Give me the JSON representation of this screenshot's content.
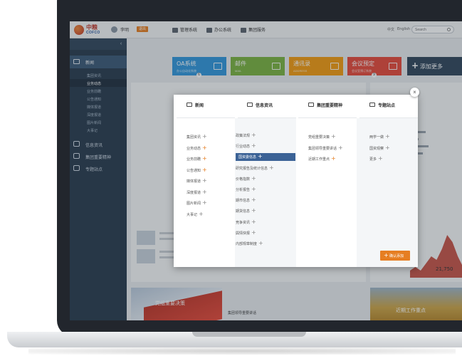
{
  "colors": {
    "sidebar": "#2c3e50",
    "sidebar_active": "#3d5a78",
    "accent_orange": "#e67e22",
    "tile_blue": "#3498db",
    "tile_green": "#7cb342",
    "tile_orange": "#f39c12",
    "tile_red": "#e74c3c",
    "tile_dark": "#34495e",
    "selected_item": "#3b6296"
  },
  "header": {
    "logo_cn": "中粮",
    "logo_en": "COFCO",
    "user_name": "李明",
    "user_tag": "退出",
    "nav": [
      {
        "label": "管理系统",
        "icon": "gear-icon"
      },
      {
        "label": "办公系统",
        "icon": "monitor-icon"
      },
      {
        "label": "集团服务",
        "icon": "eye-icon"
      }
    ],
    "lang_cn": "中文",
    "lang_en": "English",
    "search_placeholder": "Search"
  },
  "sidebar": {
    "collapse_icon": "chevron-left-icon",
    "sections": [
      {
        "label": "新闻",
        "icon": "newspaper-icon"
      },
      {
        "label": "信息资讯",
        "icon": "document-icon"
      },
      {
        "label": "集团重要精神",
        "icon": "heart-icon"
      },
      {
        "label": "专题站点",
        "icon": "image-icon"
      }
    ],
    "news_items": [
      "集团资讯",
      "业务动态",
      "业务前瞻",
      "公告通知",
      "媒体报道",
      "深度报道",
      "图片新闻",
      "大事记"
    ],
    "active_index": 1
  },
  "tiles": [
    {
      "label": "OA系统",
      "sub": "办公自动化系统",
      "badge": "6"
    },
    {
      "label": "邮件",
      "sub": "MAIL",
      "badge": ""
    },
    {
      "label": "通讯录",
      "sub": "ADDRESS",
      "badge": ""
    },
    {
      "label": "会议预定",
      "sub": "会议室预订系统",
      "badge": "9"
    }
  ],
  "more_tile": {
    "label": "添加更多"
  },
  "bottom": {
    "flag_caption": "党组重要决策",
    "field_caption": "近期工作重点",
    "list_title": "集团领导重要讲话"
  },
  "chart_data": {
    "type": "area",
    "values": [
      2,
      3,
      2,
      4,
      6,
      5,
      8,
      12,
      10,
      6,
      3,
      2
    ],
    "annotation": "21,750"
  },
  "modal": {
    "close_icon": "close-icon",
    "confirm_label": "确认添加",
    "columns": [
      {
        "title": "新闻",
        "icon": "newspaper-icon",
        "items": [
          {
            "label": "集团资讯",
            "added": false
          },
          {
            "label": "业务动态",
            "added": true
          },
          {
            "label": "业务前瞻",
            "added": true
          },
          {
            "label": "公告通知",
            "added": true
          },
          {
            "label": "媒体报道",
            "added": false
          },
          {
            "label": "深度报道",
            "added": false
          },
          {
            "label": "图片新闻",
            "added": false
          },
          {
            "label": "大事记",
            "added": false
          }
        ]
      },
      {
        "title": "信息资讯",
        "icon": "document-icon",
        "items": [
          {
            "label": "政策法规",
            "added": false
          },
          {
            "label": "行业动态",
            "added": false
          },
          {
            "label": "国资委信息",
            "added": true,
            "selected": true
          },
          {
            "label": "研究报告及统计信息",
            "added": false
          },
          {
            "label": "价格指数",
            "added": false
          },
          {
            "label": "分析报告",
            "added": false
          },
          {
            "label": "期市信息",
            "added": false
          },
          {
            "label": "期货信息",
            "added": false
          },
          {
            "label": "竞争资讯",
            "added": false
          },
          {
            "label": "舆情快报",
            "added": false
          },
          {
            "label": "内部规章制度",
            "added": false
          }
        ]
      },
      {
        "title": "集团重要精神",
        "icon": "heart-icon",
        "items": [
          {
            "label": "党组重要决策",
            "added": false
          },
          {
            "label": "集团领导重要讲话",
            "added": false
          },
          {
            "label": "近期工作重点",
            "added": true
          }
        ]
      },
      {
        "title": "专题站点",
        "icon": "image-icon",
        "items": [
          {
            "label": "两学一做",
            "added": false
          },
          {
            "label": "国资观察",
            "added": false
          },
          {
            "label": "更多",
            "added": false
          }
        ]
      }
    ]
  }
}
